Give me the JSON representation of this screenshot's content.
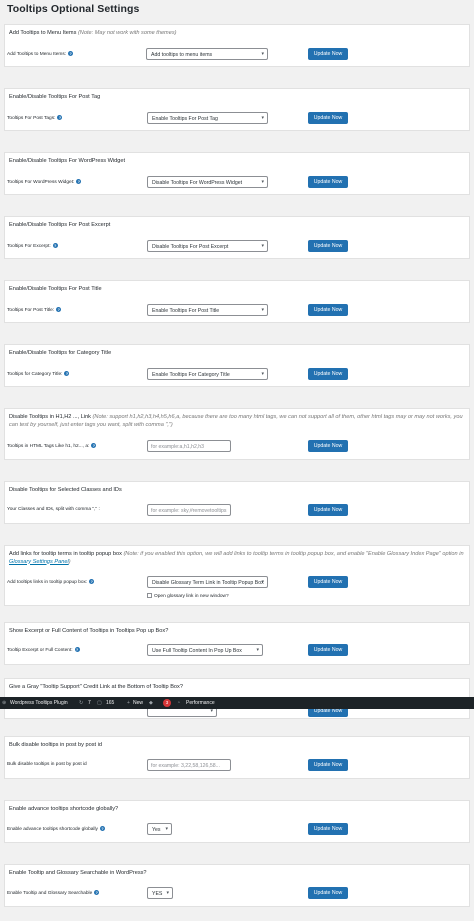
{
  "page_title": "Tooltips Optional Settings",
  "update_label": "Update Now",
  "sections": [
    {
      "title": "Add Tooltips to Menu Items",
      "note": "(Note: May not work with some themes)",
      "label": "Add Tooltips to Menu Items:",
      "value": "Add tooltips to menu items"
    },
    {
      "title": "Enable/Disable Tooltips For Post Tag",
      "label": "Tooltips For Post Tags:",
      "value": "Enable Tooltips For Post Tag"
    },
    {
      "title": "Enable/Disable Tooltips For WordPress Widget",
      "label": "Tooltips For WordPress Widget:",
      "value": "Disable Tooltips For WordPress Widget"
    },
    {
      "title": "Enable/Disable Tooltips For Post Excerpt",
      "label": "Tooltips For Excerpt:",
      "value": "Disable Tooltips For Post Excerpt"
    },
    {
      "title": "Enable/Disable Tooltips For Post Title",
      "label": "Tooltips For Post Title:",
      "value": "Enable Tooltips For Post Title"
    },
    {
      "title": "Enable/Disable Tooltips for Category Title",
      "label": "Tooltips for Category Title:",
      "value": "Enable Tooltips For Category Title"
    },
    {
      "title": "Disable Tooltips in H1,H2 ..., Link",
      "note": "(Note: support h1,h2,h3,h4,h5,h6,a, because there are too many html tags, we can not support all of them, other html tags may or may not works, you can test by yourself, just enter tags you want, split with comma \",\")",
      "label": "Tooltips in HTML Tags Like h1, h2..., a:",
      "placeholder": "for example:a,h1,h2,h3"
    },
    {
      "title": "Disable Tooltips for Selected Classes and IDs",
      "label": "Your Classes and IDs, split with comma \",\" :",
      "placeholder": "for example: sky,#removetooltips"
    },
    {
      "title": "Add links for tooltip terms in tooltip popup box",
      "note": "(Note: if you enabled this option, we will add links to tooltip terms in tooltip popup box, and enable \"Enable Glossary Index Page\" option in",
      "note_link": "Glossary Settings Panel",
      "note_end": ")",
      "label": "Add tooltips links in tooltip popup box:",
      "value": "Disable Glossary Term Link in Tooltip Popup Box",
      "checkbox_label": "Open glossary link in new window?"
    },
    {
      "title": "Show Excerpt or Full Content of Tooltips in Tooltips Pop up Box?",
      "label": "Tooltip Excerpt or Full Content:",
      "value": "Use Full Tooltip Content In Pop Up Box"
    },
    {
      "title": "Give a Gray \"Tooltip Support\" Credit Link at the Bottom of Tooltip Box?"
    },
    {
      "title": "Bulk disable tooltips in post by post id",
      "label": "Bulk disable tooltips in post by post id",
      "placeholder": "for example: 3,22,58,126,58..."
    },
    {
      "title": "Enable advance tooltips shortcode globally?",
      "label": "Enable advance tooltips shortcode globally",
      "value": "Yes"
    },
    {
      "title": "Enable Tooltip and Glossary Searchable in WordPress?",
      "label": "Enable Tooltip and Glossary Searchable",
      "value": "YES"
    }
  ],
  "admin_bar": {
    "site_name": "Wordpress Tooltips Plugin",
    "updates": "7",
    "comments": "165",
    "new_label": "New",
    "notifications": "3",
    "performance_label": "Performance"
  }
}
